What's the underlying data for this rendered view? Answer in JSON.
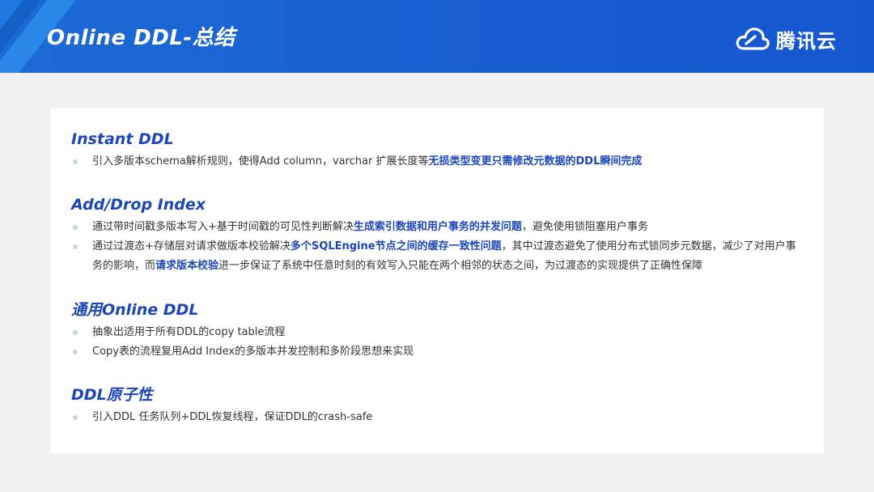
{
  "header": {
    "title": "Online DDL-总结",
    "logo_text": "腾讯云"
  },
  "sections": [
    {
      "title": "Instant DDL",
      "items": [
        {
          "t1": "引入多版本schema解析规则，使得Add column，varchar 扩展长度等",
          "h1": "无损类型变更只需修改元数据的DDL瞬间完成"
        }
      ]
    },
    {
      "title": "Add/Drop Index",
      "items": [
        {
          "t1": "通过带时间戳多版本写入+基于时间戳的可见性判断解决",
          "h1": "生成索引数据和用户事务的并发问题",
          "t2": "，避免使用锁阻塞用户事务"
        },
        {
          "t1": "通过过渡态+存储层对请求做版本校验解决",
          "h1": "多个SQLEngine节点之间的缓存一致性问题",
          "t2": "，其中过渡态避免了使用分布式锁同步元数据，减少了对用户事务的影响，而",
          "h2": "请求版本校验",
          "t3": "进一步保证了系统中任意时刻的有效写入只能在两个相邻的状态之间，为过渡态的实现提供了正确性保障"
        }
      ]
    },
    {
      "title": "通用Online DDL",
      "items": [
        {
          "t1": "抽象出适用于所有DDL的copy table流程"
        },
        {
          "t1": "Copy表的流程复用Add Index的多版本并发控制和多阶段思想来实现"
        }
      ]
    },
    {
      "title": "DDL原子性",
      "items": [
        {
          "t1": "引入DDL 任务队列+DDL恢复线程，保证DDL的crash-safe"
        }
      ]
    }
  ]
}
